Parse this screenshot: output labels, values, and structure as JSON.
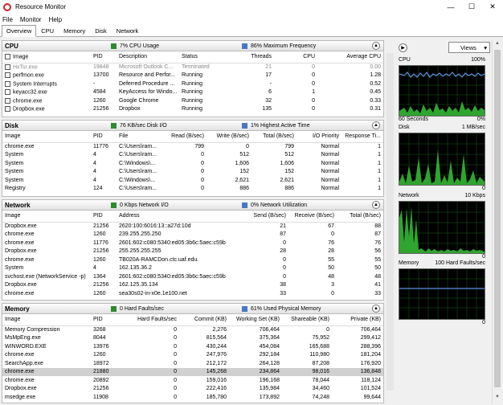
{
  "window": {
    "title": "Resource Monitor",
    "minimize": "—",
    "maximize": "☐",
    "close": "✕"
  },
  "menu": [
    "File",
    "Monitor",
    "Help"
  ],
  "tabs": [
    "Overview",
    "CPU",
    "Memory",
    "Disk",
    "Network"
  ],
  "cpu": {
    "title": "CPU",
    "stat1": "7% CPU Usage",
    "stat1_color": "#2e8b2e",
    "stat2": "86% Maximum Frequency",
    "stat2_color": "#4a78c0",
    "columns": [
      "Image",
      "PID",
      "Description",
      "Status",
      "Threads",
      "CPU",
      "Average CPU"
    ],
    "rows": [
      [
        "HxTsr.exe",
        "19848",
        "Microsoft Outlook C...",
        "Terminated",
        "21",
        "0",
        "0.00"
      ],
      [
        "perfmon.exe",
        "13700",
        "Resource and Perfor...",
        "Running",
        "17",
        "0",
        "1.28"
      ],
      [
        "System Interrupts",
        "-",
        "Deferred Procedure ...",
        "Running",
        "-",
        "0",
        "0.52"
      ],
      [
        "keyacc32.exe",
        "4584",
        "KeyAccess for Windo...",
        "Running",
        "6",
        "1",
        "0.45"
      ],
      [
        "chrome.exe",
        "1260",
        "Google Chrome",
        "Running",
        "32",
        "0",
        "0.33"
      ],
      [
        "Dropbox.exe",
        "21256",
        "Dropbox",
        "Running",
        "135",
        "0",
        "0.31"
      ]
    ]
  },
  "disk": {
    "title": "Disk",
    "stat1": "76 KB/sec Disk I/O",
    "stat1_color": "#2e8b2e",
    "stat2": "1% Highest Active Time",
    "stat2_color": "#4a78c0",
    "columns": [
      "Image",
      "PID",
      "File",
      "Read (B/sec)",
      "Write (B/sec)",
      "Total (B/sec)",
      "I/O Priority",
      "Response Ti..."
    ],
    "rows": [
      [
        "chrome.exe",
        "11776",
        "C:\\Users\\ram...",
        "799",
        "0",
        "799",
        "Normal",
        "1"
      ],
      [
        "System",
        "4",
        "C:\\Users\\ram...",
        "0",
        "512",
        "512",
        "Normal",
        "1"
      ],
      [
        "System",
        "4",
        "C:\\Windows\\...",
        "0",
        "1,606",
        "1,606",
        "Normal",
        "1"
      ],
      [
        "System",
        "4",
        "C:\\Users\\ram...",
        "0",
        "152",
        "152",
        "Normal",
        "1"
      ],
      [
        "System",
        "4",
        "C:\\Windows\\...",
        "0",
        "2,621",
        "2,621",
        "Normal",
        "1"
      ],
      [
        "Registry",
        "124",
        "C:\\Users\\ram...",
        "0",
        "886",
        "886",
        "Normal",
        "1"
      ]
    ]
  },
  "network": {
    "title": "Network",
    "stat1": "0 Kbps Network I/O",
    "stat1_color": "#2e8b2e",
    "stat2": "0% Network Utilization",
    "stat2_color": "#4a78c0",
    "columns": [
      "Image",
      "PID",
      "Address",
      "Send (B/sec)",
      "Receive (B/sec)",
      "Total (B/sec)"
    ],
    "rows": [
      [
        "Dropbox.exe",
        "21256",
        "2620:100:6016:13::a27d:10d",
        "21",
        "67",
        "88"
      ],
      [
        "chrome.exe",
        "1260",
        "239.255.255.250",
        "87",
        "0",
        "87"
      ],
      [
        "chrome.exe",
        "11776",
        "2601:602:c080:5340:ed05:3b6c:5aec:c59b",
        "0",
        "76",
        "76"
      ],
      [
        "Dropbox.exe",
        "21256",
        "255.255.255.255",
        "28",
        "28",
        "56"
      ],
      [
        "chrome.exe",
        "1260",
        "TB020A-RAMCDon.ctc.uaf.edu.",
        "0",
        "55",
        "55"
      ],
      [
        "System",
        "4",
        "162.135.36.2",
        "0",
        "50",
        "50"
      ],
      [
        "svchost.exe (NetworkService -p)",
        "1364",
        "2601:602:c080:5340:ed05:3b6c:5aec:c59b",
        "0",
        "48",
        "48"
      ],
      [
        "Dropbox.exe",
        "21256",
        "162.125.35.134",
        "38",
        "3",
        "41"
      ],
      [
        "chrome.exe",
        "1260",
        "sea30s02-in-x0e.1e100.net",
        "33",
        "0",
        "33"
      ]
    ]
  },
  "memory": {
    "title": "Memory",
    "stat1": "0 Hard Faults/sec",
    "stat1_color": "#2e8b2e",
    "stat2": "61% Used Physical Memory",
    "stat2_color": "#4a78c0",
    "columns": [
      "Image",
      "PID",
      "Hard Faults/sec",
      "Commit (KB)",
      "Working Set (KB)",
      "Shareable (KB)",
      "Private (KB)"
    ],
    "rows": [
      [
        "Memory Compression",
        "3268",
        "0",
        "2,276",
        "706,464",
        "0",
        "706,464"
      ],
      [
        "MsMpEng.exe",
        "8044",
        "0",
        "815,564",
        "375,364",
        "75,952",
        "299,412"
      ],
      [
        "WINWORD.EXE",
        "13976",
        "0",
        "430,244",
        "454,084",
        "165,688",
        "288,396"
      ],
      [
        "chrome.exe",
        "1260",
        "0",
        "247,976",
        "292,184",
        "110,980",
        "181,204"
      ],
      [
        "SearchApp.exe",
        "18972",
        "0",
        "212,172",
        "264,128",
        "87,208",
        "176,920"
      ],
      [
        "chrome.exe",
        "21880",
        "0",
        "145,268",
        "234,864",
        "98,016",
        "136,848"
      ],
      [
        "chrome.exe",
        "20892",
        "0",
        "159,016",
        "196,168",
        "78,044",
        "118,124"
      ],
      [
        "Dropbox.exe",
        "21256",
        "0",
        "222,416",
        "135,984",
        "34,460",
        "101,524"
      ],
      [
        "msedge.exe",
        "11908",
        "0",
        "185,780",
        "173,892",
        "74,248",
        "99,644"
      ]
    ]
  },
  "graphs": {
    "views_label": "Views",
    "cpu": {
      "name": "CPU",
      "max": "100%",
      "footer_left": "60 Seconds",
      "footer_right": "0%"
    },
    "disk": {
      "name": "Disk",
      "max": "1 MB/sec",
      "footer_left": "",
      "footer_right": "0"
    },
    "network": {
      "name": "Network",
      "max": "10 Kbps",
      "footer_left": "",
      "footer_right": "0"
    },
    "memory": {
      "name": "Memory",
      "max": "100 Hard Faults/sec",
      "footer_left": "",
      "footer_right": "0"
    }
  }
}
